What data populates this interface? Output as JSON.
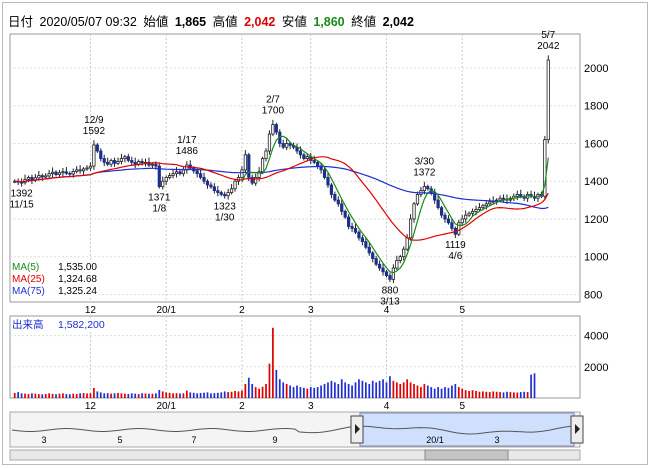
{
  "info": {
    "date_label": "日付",
    "date": "2020/05/07 09:32",
    "open_label": "始値",
    "open": "1,865",
    "high_label": "高値",
    "high": "2,042",
    "low_label": "安値",
    "low": "1,860",
    "close_label": "終値",
    "close": "2,042"
  },
  "colors": {
    "ma5": "#1a8a1a",
    "ma25": "#e00000",
    "ma75": "#1f2fd0",
    "candle_down": "#1a2f8f",
    "volume_up": "#e00000",
    "volume_down": "#1f2fd0"
  },
  "legend": [
    {
      "label": "MA(5)",
      "value": "1,535.00"
    },
    {
      "label": "MA(25)",
      "value": "1,324.68"
    },
    {
      "label": "MA(75)",
      "value": "1,325.24"
    }
  ],
  "volume_legend": {
    "label": "出来高",
    "value": "1,582,200"
  },
  "chart_data": [
    {
      "type": "candlestick",
      "x_ticks": [
        "12",
        "20/1",
        "2",
        "3",
        "4",
        "5"
      ],
      "y_ticks": [
        800,
        1000,
        1200,
        1400,
        1600,
        1800,
        2000
      ],
      "ylim": [
        760,
        2180
      ],
      "annotations": [
        {
          "date": "12/9",
          "value": "1592",
          "kind": "high"
        },
        {
          "date": "11/15",
          "value": "1392",
          "kind": "low"
        },
        {
          "date": "1/17",
          "value": "1486",
          "kind": "high"
        },
        {
          "date": "1/8",
          "value": "1371",
          "kind": "low"
        },
        {
          "date": "1/30",
          "value": "1323",
          "kind": "low"
        },
        {
          "date": "2/7",
          "value": "1700",
          "kind": "high"
        },
        {
          "date": "3/13",
          "value": "880",
          "kind": "low"
        },
        {
          "date": "3/30",
          "value": "1372",
          "kind": "high"
        },
        {
          "date": "4/6",
          "value": "1119",
          "kind": "low"
        },
        {
          "date": "5/7",
          "value": "2042",
          "kind": "high"
        }
      ],
      "close": [
        1400,
        1395,
        1392,
        1410,
        1420,
        1405,
        1418,
        1430,
        1422,
        1428,
        1440,
        1448,
        1435,
        1445,
        1450,
        1442,
        1438,
        1452,
        1460,
        1455,
        1465,
        1470,
        1480,
        1592,
        1560,
        1520,
        1500,
        1490,
        1510,
        1495,
        1505,
        1520,
        1530,
        1510,
        1500,
        1490,
        1505,
        1498,
        1500,
        1485,
        1490,
        1480,
        1371,
        1400,
        1420,
        1430,
        1440,
        1450,
        1440,
        1460,
        1486,
        1470,
        1455,
        1440,
        1420,
        1400,
        1380,
        1370,
        1350,
        1340,
        1330,
        1323,
        1340,
        1360,
        1400,
        1420,
        1460,
        1540,
        1420,
        1390,
        1420,
        1450,
        1520,
        1560,
        1650,
        1700,
        1660,
        1600,
        1580,
        1600,
        1590,
        1580,
        1560,
        1540,
        1520,
        1530,
        1510,
        1500,
        1480,
        1460,
        1420,
        1380,
        1330,
        1300,
        1280,
        1240,
        1210,
        1160,
        1150,
        1130,
        1100,
        1080,
        1050,
        1020,
        990,
        960,
        940,
        920,
        900,
        880,
        940,
        980,
        1000,
        1040,
        1100,
        1200,
        1280,
        1330,
        1350,
        1372,
        1360,
        1340,
        1300,
        1260,
        1220,
        1200,
        1180,
        1150,
        1119,
        1180,
        1200,
        1220,
        1230,
        1240,
        1250,
        1260,
        1270,
        1280,
        1290,
        1295,
        1300,
        1310,
        1305,
        1300,
        1310,
        1320,
        1330,
        1320,
        1310,
        1330,
        1320,
        1310,
        1330,
        1320,
        1620,
        2042
      ],
      "ma": [
        {
          "name": "MA(5)",
          "ref": "legend.0"
        },
        {
          "name": "MA(25)",
          "ref": "legend.1"
        },
        {
          "name": "MA(75)",
          "ref": "legend.2"
        }
      ]
    },
    {
      "type": "bar",
      "name": "出来高",
      "y_ticks": [
        2000,
        4000
      ],
      "ylim": [
        0,
        5000
      ],
      "values": [
        320,
        380,
        300,
        280,
        260,
        300,
        280,
        250,
        240,
        260,
        300,
        260,
        240,
        280,
        300,
        250,
        240,
        280,
        260,
        300,
        320,
        290,
        300,
        640,
        420,
        360,
        300,
        310,
        280,
        300,
        320,
        300,
        280,
        260,
        300,
        280,
        260,
        300,
        290,
        280,
        270,
        300,
        520,
        420,
        360,
        330,
        300,
        310,
        290,
        300,
        480,
        360,
        330,
        300,
        320,
        340,
        360,
        300,
        310,
        330,
        360,
        420,
        380,
        400,
        450,
        420,
        480,
        900,
        1300,
        900,
        700,
        600,
        720,
        900,
        2200,
        4500,
        1800,
        1200,
        1000,
        900,
        800,
        700,
        800,
        700,
        650,
        600,
        700,
        650,
        700,
        800,
        900,
        1000,
        1100,
        1000,
        900,
        1200,
        1000,
        900,
        800,
        1000,
        1200,
        1100,
        1000,
        900,
        1100,
        1000,
        1100,
        1200,
        1000,
        1400,
        1100,
        1000,
        900,
        1000,
        1200,
        1000,
        900,
        800,
        700,
        900,
        800,
        700,
        600,
        700,
        600,
        700,
        650,
        800,
        900,
        700,
        600,
        500,
        450,
        500,
        450,
        400,
        420,
        400,
        380,
        420,
        400,
        380,
        360,
        400,
        380,
        360,
        350,
        380,
        400,
        380,
        1500,
        1580
      ]
    }
  ],
  "navigator": {
    "labels": [
      "3",
      "5",
      "7",
      "9",
      "20/1",
      "3"
    ]
  }
}
